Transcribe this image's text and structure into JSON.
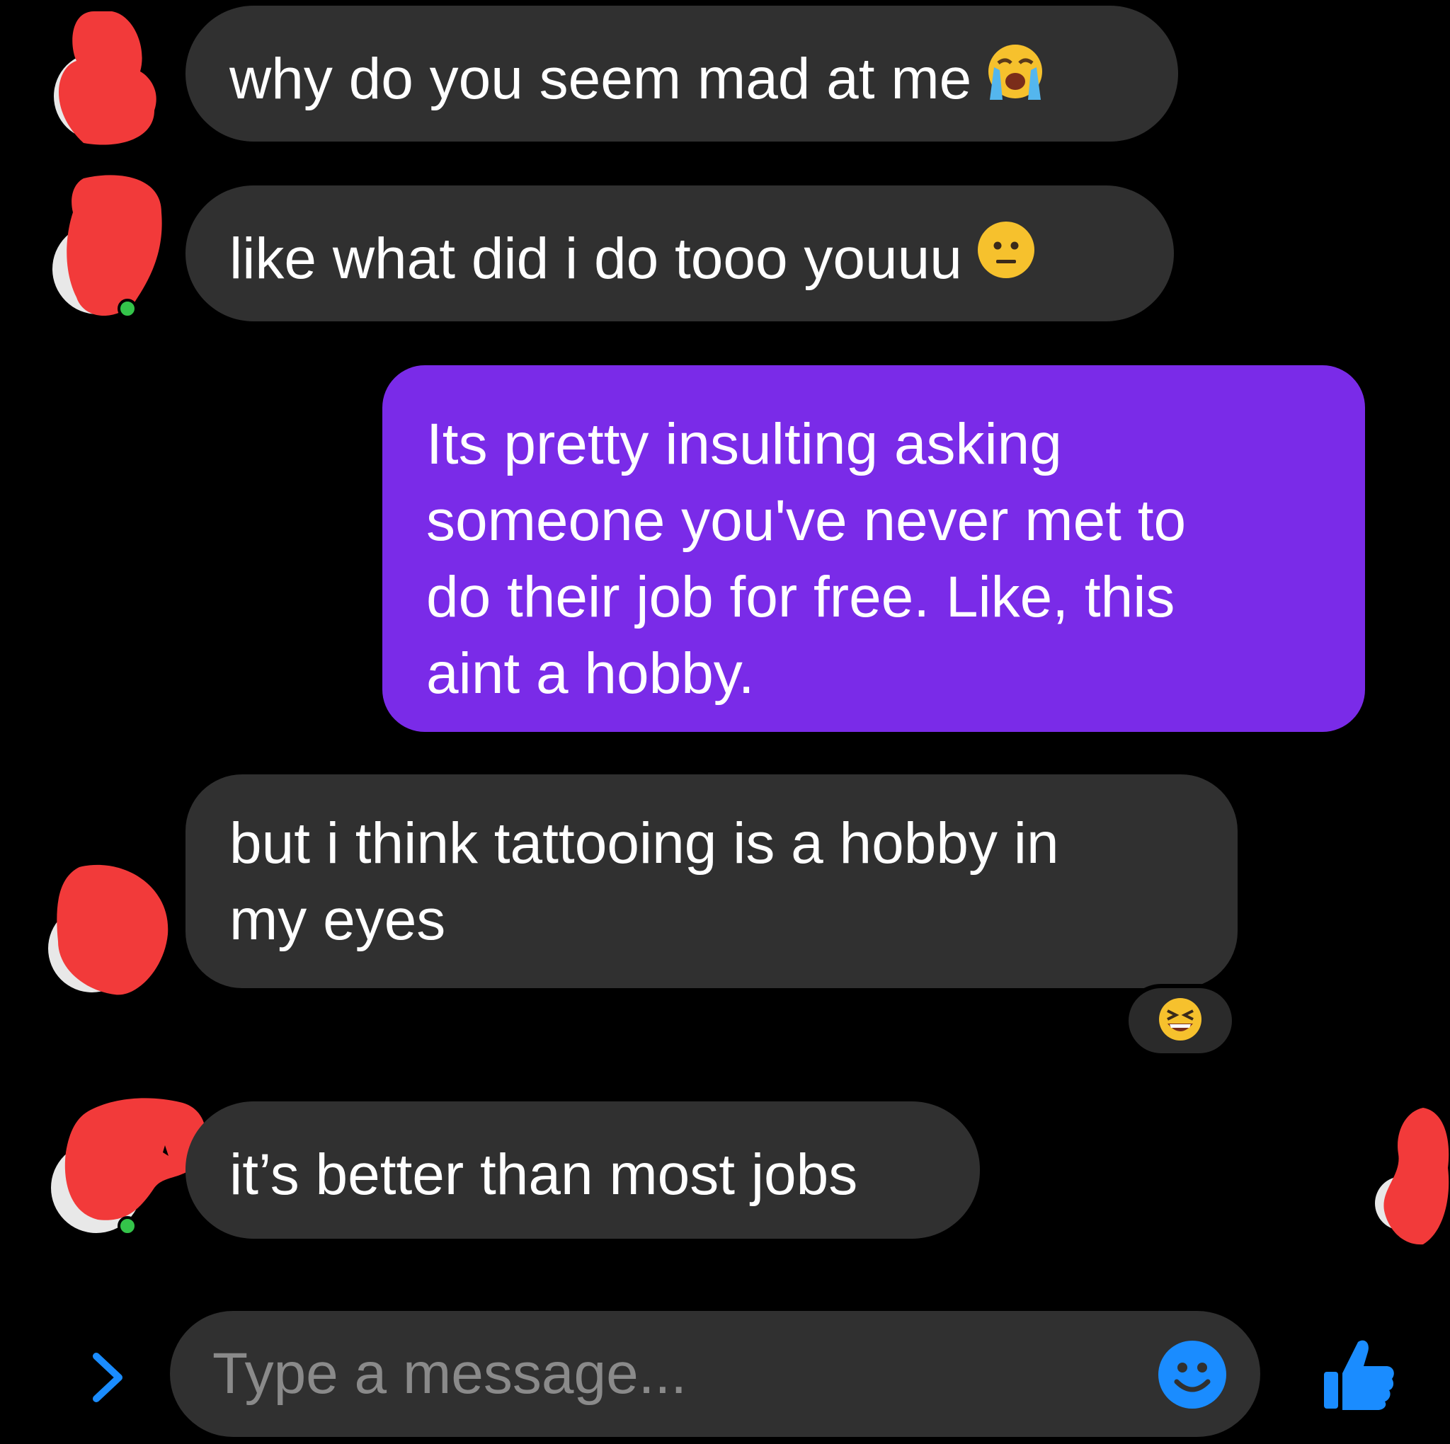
{
  "conversation": {
    "messages": [
      {
        "sender": "other",
        "text": "why do you seem mad at me",
        "emoji": "loudly-crying-face-emoji"
      },
      {
        "sender": "other",
        "text": "like what did i do tooo youuu",
        "emoji": "neutral-face-emoji"
      },
      {
        "sender": "me",
        "lines": [
          "Its pretty insulting asking",
          "someone you've never met to",
          "do their job for free. Like, this",
          "aint a hobby."
        ]
      },
      {
        "sender": "other",
        "lines": [
          "but i think tattooing is a hobby in",
          "my eyes"
        ],
        "reaction": "grinning-squinting-face-emoji"
      },
      {
        "sender": "other",
        "text": "it’s better than most jobs"
      }
    ]
  },
  "composer": {
    "placeholder": "Type a message...",
    "expand_icon": "chevron-right-icon",
    "emoji_icon": "smiley-icon",
    "send_icon": "thumbs-up-icon"
  },
  "colors": {
    "background": "#000000",
    "incoming_bubble": "#303030",
    "outgoing_bubble": "#7a2be8",
    "accent": "#1a8cff",
    "avatar_redaction": "#f23a3a",
    "online_dot": "#34c44a"
  }
}
